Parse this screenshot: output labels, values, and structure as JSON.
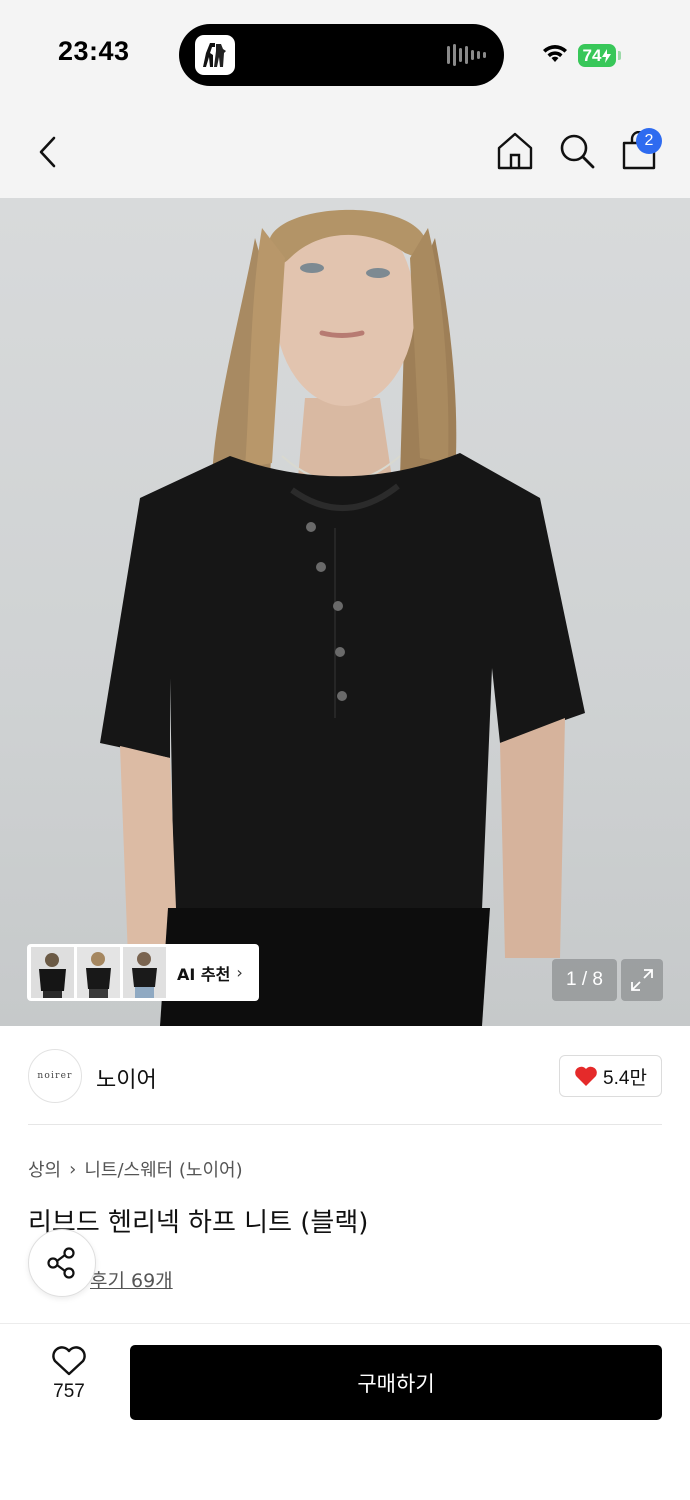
{
  "status_bar": {
    "time": "23:43",
    "battery_level": "74",
    "icons": [
      "app-icon",
      "audio-wave-icon",
      "wifi-icon",
      "battery-charging-icon"
    ]
  },
  "nav": {
    "icons": [
      "back-chevron-icon",
      "home-icon",
      "search-icon",
      "shopping-bag-icon"
    ],
    "cart_badge": "2"
  },
  "hero": {
    "page_counter": "1 / 8",
    "ai_recommend_label": "AI 추천",
    "ai_chevron": "›",
    "icons": [
      "expand-icon"
    ]
  },
  "brand": {
    "logo_text": "noirer",
    "name": "노이어",
    "like_count": "5.4만",
    "accent_color": "#e52a2a"
  },
  "product": {
    "breadcrumb": [
      "상의",
      "니트/스웨터 (노이어)"
    ],
    "breadcrumb_separator": "›",
    "title": "리브드 헨리넥 하프 니트 (블랙)",
    "review_link": "후기 69개"
  },
  "bottom_bar": {
    "wish_count": "757",
    "buy_label": "구매하기"
  },
  "colors": {
    "badge": "#2e6bf0",
    "buy_button": "#000000",
    "battery": "#38c759"
  }
}
